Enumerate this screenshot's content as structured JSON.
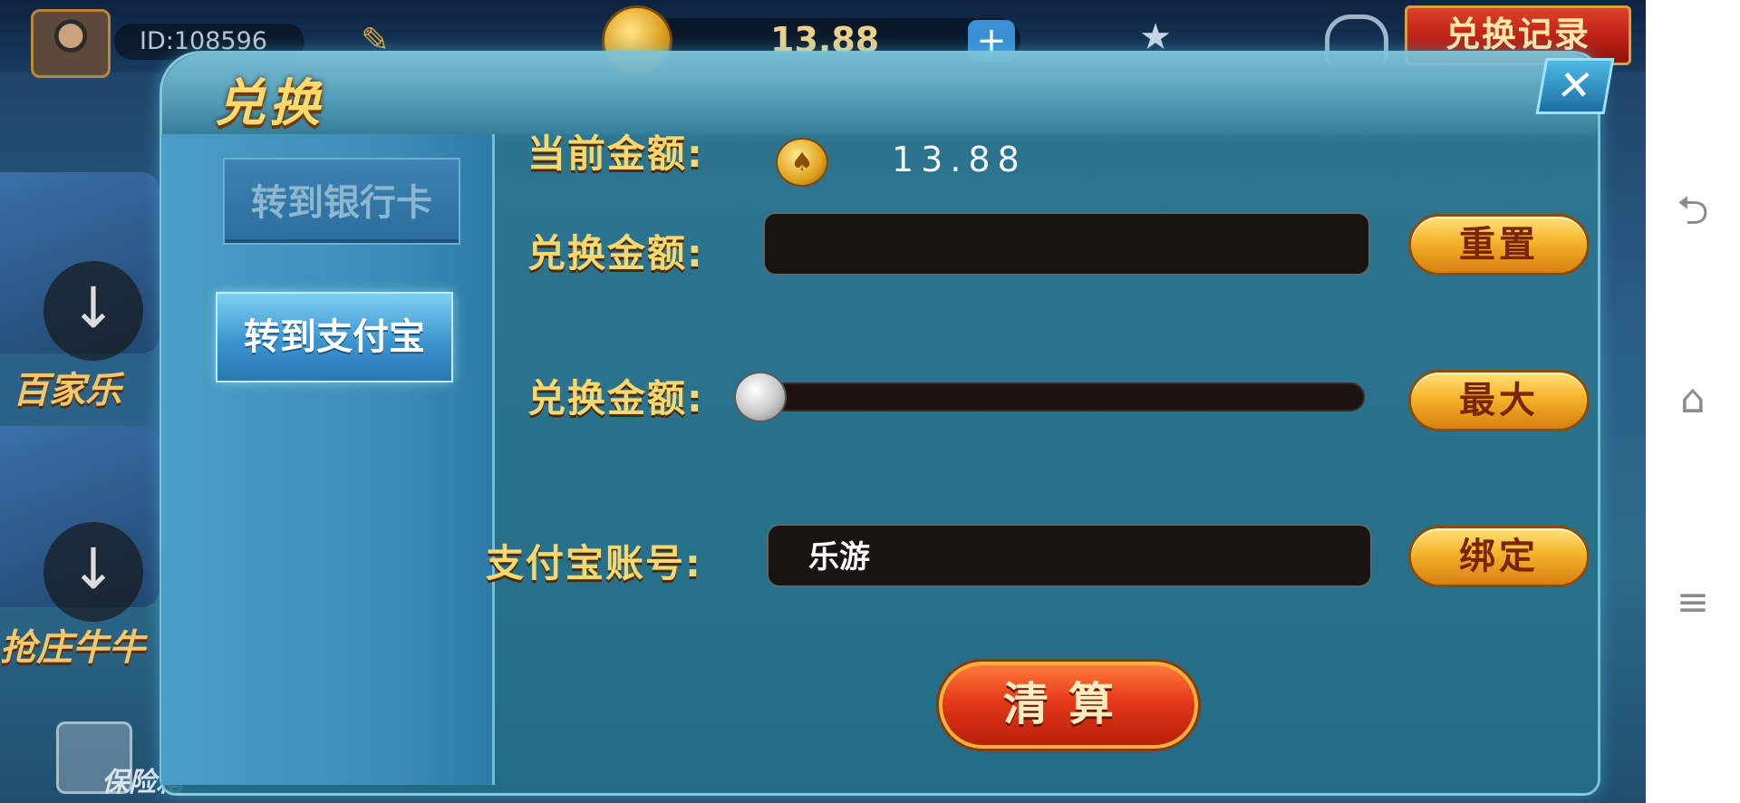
{
  "header": {
    "user_id": "ID:108596",
    "coin_balance": "13.88",
    "plus_label": "+",
    "exchange_record_label": "兑换记录"
  },
  "lobby": {
    "tiles": [
      {
        "label": "百家乐"
      },
      {
        "label": "抢庄牛牛"
      }
    ],
    "vault_label": "保险箱"
  },
  "dialog": {
    "title": "兑换",
    "close_glyph": "✕",
    "tabs": [
      {
        "label": "转到银行卡",
        "active": false
      },
      {
        "label": "转到支付宝",
        "active": true
      }
    ],
    "current_amount_label": "当前金额:",
    "current_amount_value": "13.88",
    "exchange_amount_label": "兑换金额:",
    "exchange_amount_value": "",
    "slider_label": "兑换金额:",
    "slider_value": 0,
    "alipay_account_label": "支付宝账号:",
    "alipay_account_value": "乐游",
    "reset_label": "重置",
    "max_label": "最大",
    "bind_label": "绑定",
    "settle_label": "清算"
  },
  "icons": {
    "edit": "pencil-icon",
    "trophy": "trophy-icon",
    "support": "headset-icon",
    "coin": "spade-coin-icon",
    "download": "download-icon"
  },
  "navbar": {
    "back_glyph": "⮌",
    "home_glyph": "⌂",
    "menu_glyph": "≡"
  },
  "colors": {
    "gold_text": "#f7d86e",
    "dialog_teal": "#2f7aa6",
    "settle_red": "#e4391a",
    "gold_button": "#f5b42a"
  }
}
